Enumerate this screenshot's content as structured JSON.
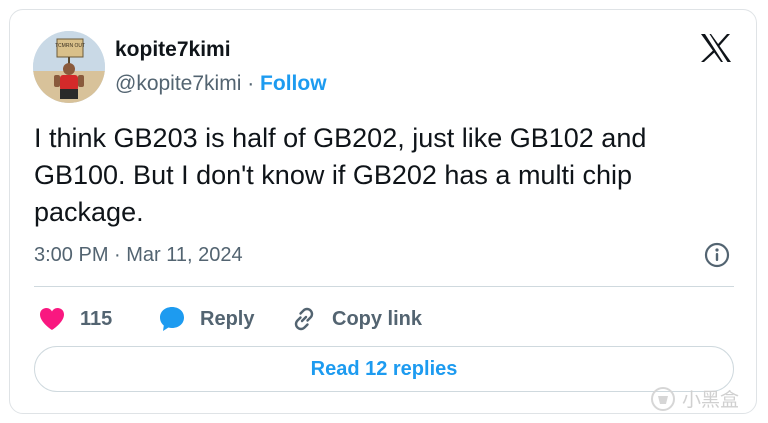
{
  "author": {
    "display_name": "kopite7kimi",
    "handle": "@kopite7kimi",
    "separator": "·",
    "follow_label": "Follow",
    "avatar_sign_text": "TCMRN OUT"
  },
  "tweet": {
    "text": "I think GB203 is half of GB202, just like GB102 and\nGB100. But I don't know if GB202 has a multi chip\npackage.",
    "timestamp": "3:00 PM · Mar 11, 2024"
  },
  "actions": {
    "like_count": "115",
    "reply_label": "Reply",
    "copy_link_label": "Copy link"
  },
  "footer": {
    "read_replies_label": "Read 12 replies"
  },
  "watermark": {
    "text": "小黑盒"
  },
  "colors": {
    "accent": "#1d9bf0",
    "like": "#f91880",
    "text_primary": "#0f1419",
    "text_secondary": "#536471",
    "border": "#cfd9de"
  },
  "icons": {
    "brand": "x-logo-icon",
    "info": "info-icon",
    "like": "heart-icon",
    "reply": "speech-bubble-icon",
    "copy": "link-icon"
  }
}
